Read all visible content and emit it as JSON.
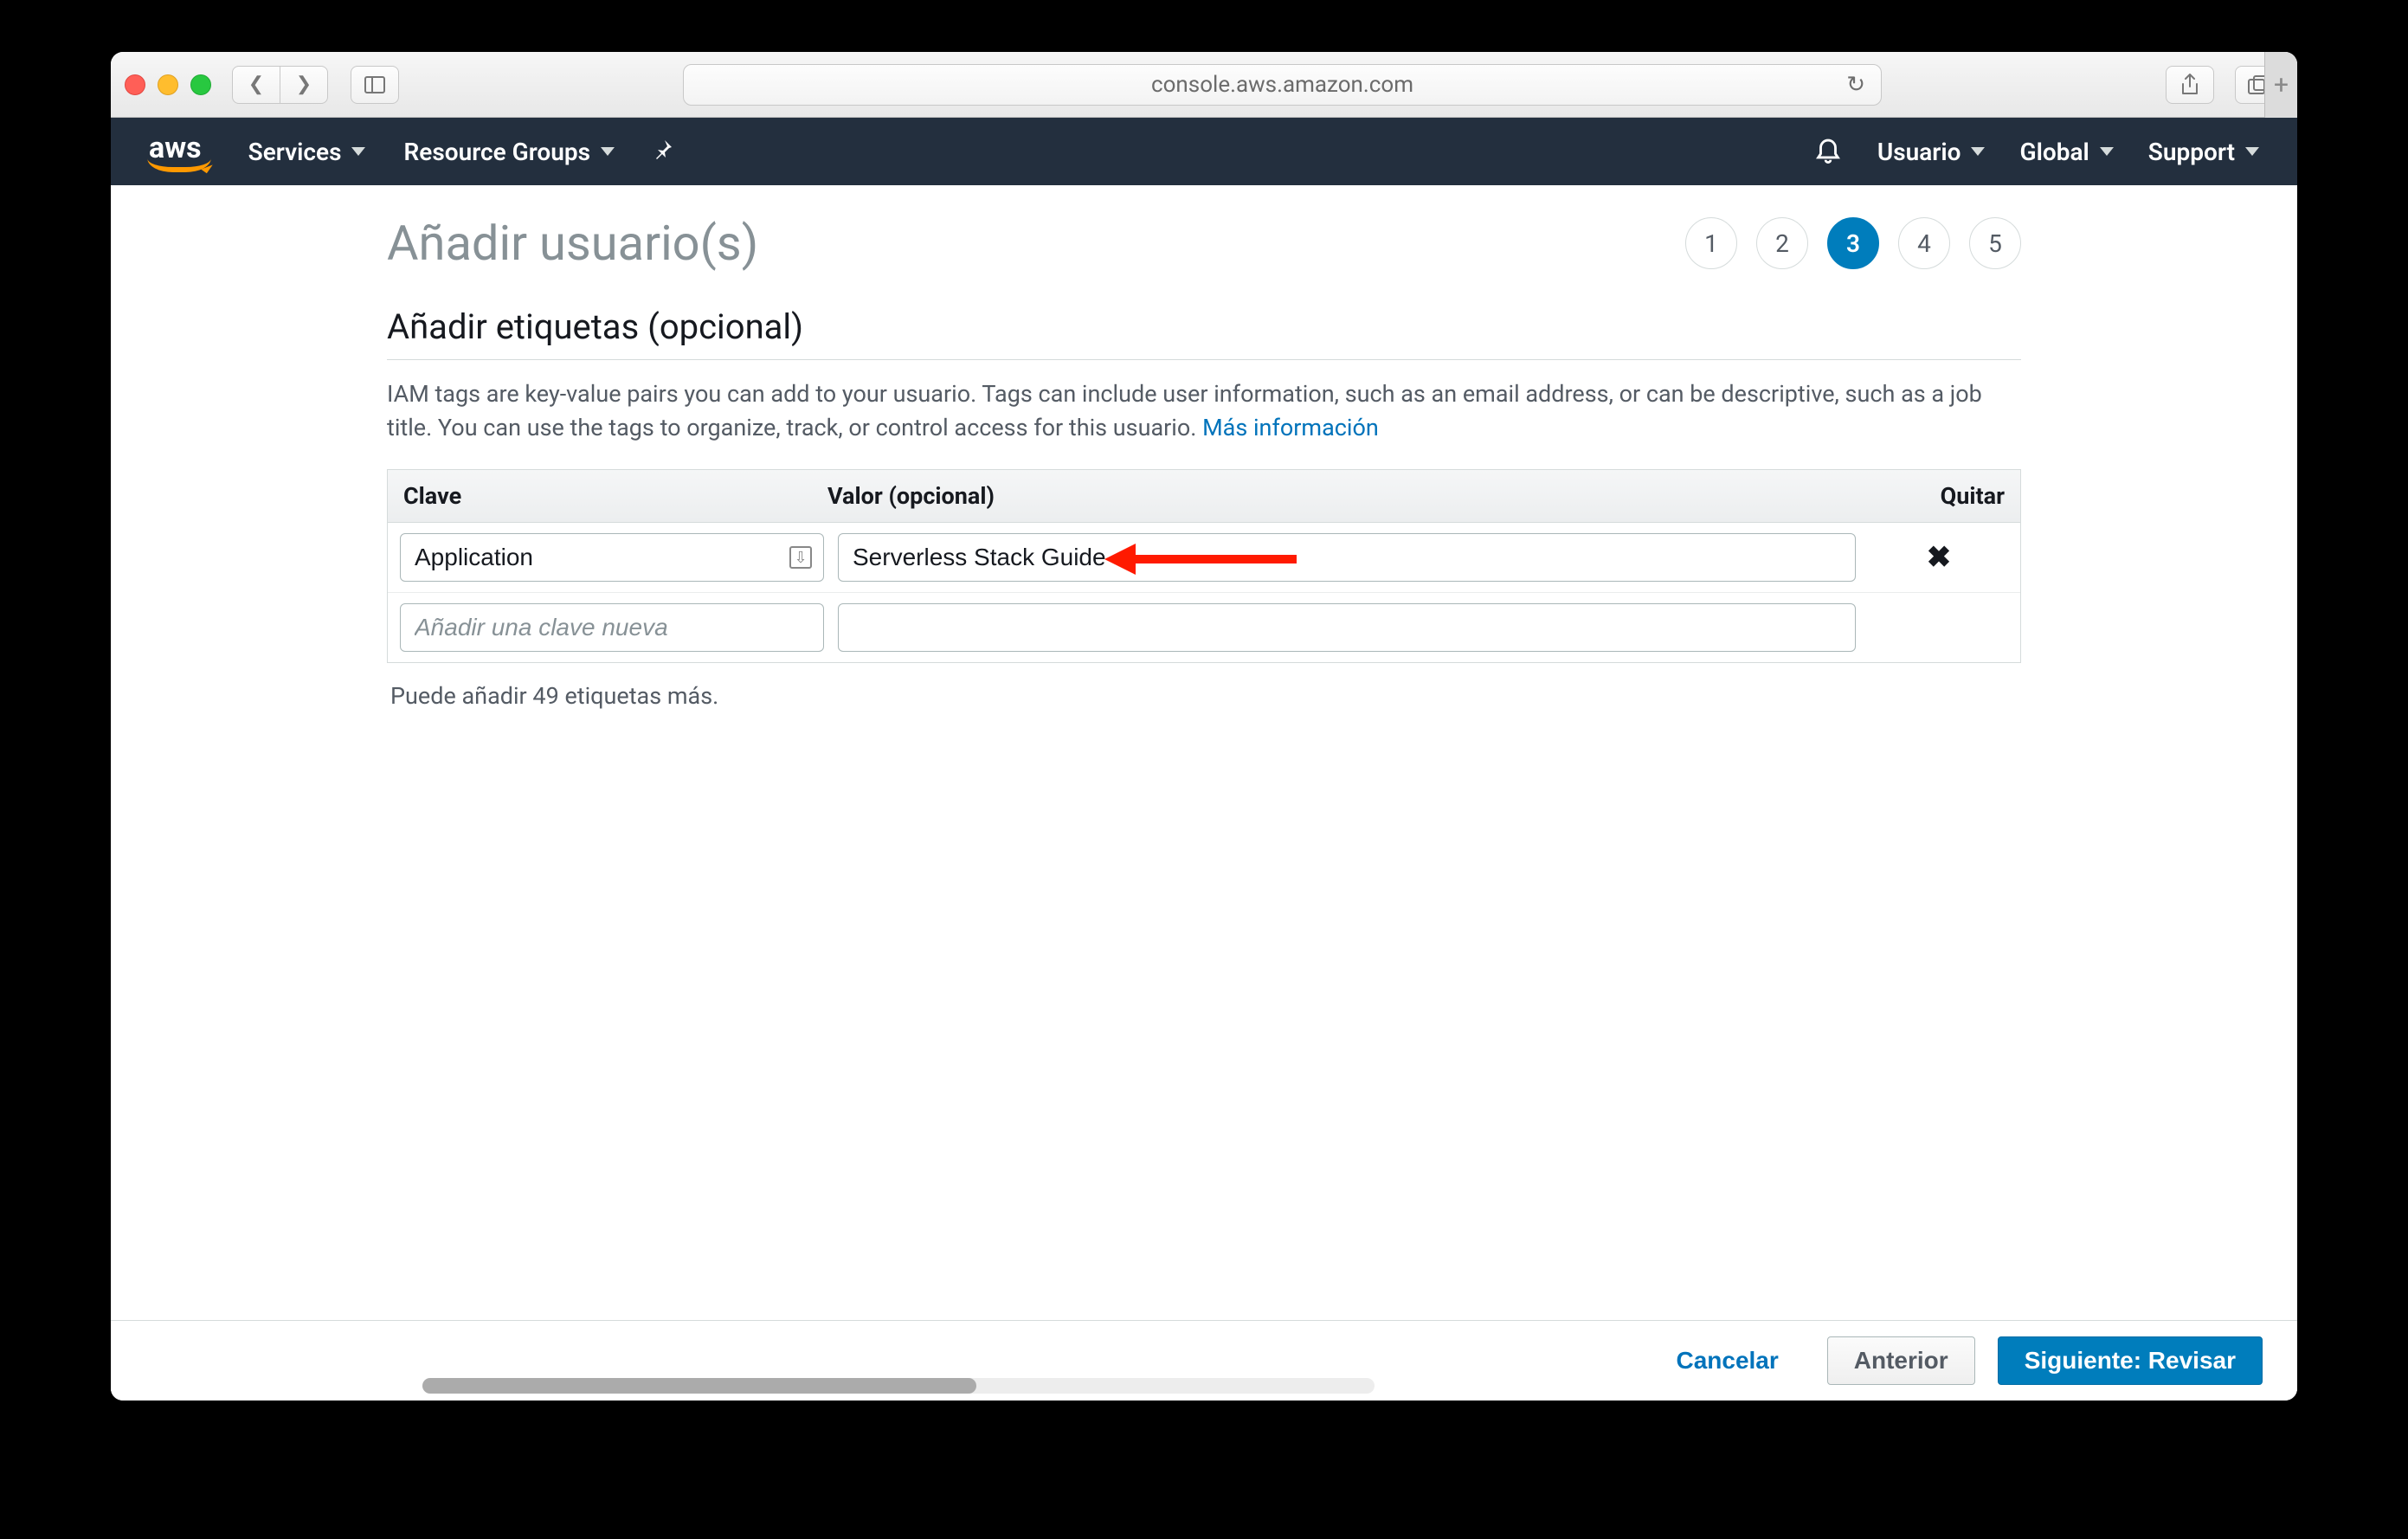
{
  "browser": {
    "url": "console.aws.amazon.com"
  },
  "aws_nav": {
    "services": "Services",
    "resource_groups": "Resource Groups",
    "user": "Usuario",
    "region": "Global",
    "support": "Support"
  },
  "page": {
    "title": "Añadir usuario(s)",
    "steps": [
      "1",
      "2",
      "3",
      "4",
      "5"
    ],
    "active_step_index": 2
  },
  "section": {
    "title": "Añadir etiquetas (opcional)",
    "description": "IAM tags are key-value pairs you can add to your usuario. Tags can include user information, such as an email address, or can be descriptive, such as a job title. You can use the tags to organize, track, or control access for this usuario. ",
    "more_info": "Más información"
  },
  "table": {
    "col_key": "Clave",
    "col_value": "Valor (opcional)",
    "col_remove": "Quitar",
    "rows": [
      {
        "key": "Application",
        "value": "Serverless Stack Guide"
      }
    ],
    "new_key_placeholder": "Añadir una clave nueva",
    "remaining": "Puede añadir 49 etiquetas más."
  },
  "footer": {
    "cancel": "Cancelar",
    "previous": "Anterior",
    "next": "Siguiente: Revisar"
  }
}
